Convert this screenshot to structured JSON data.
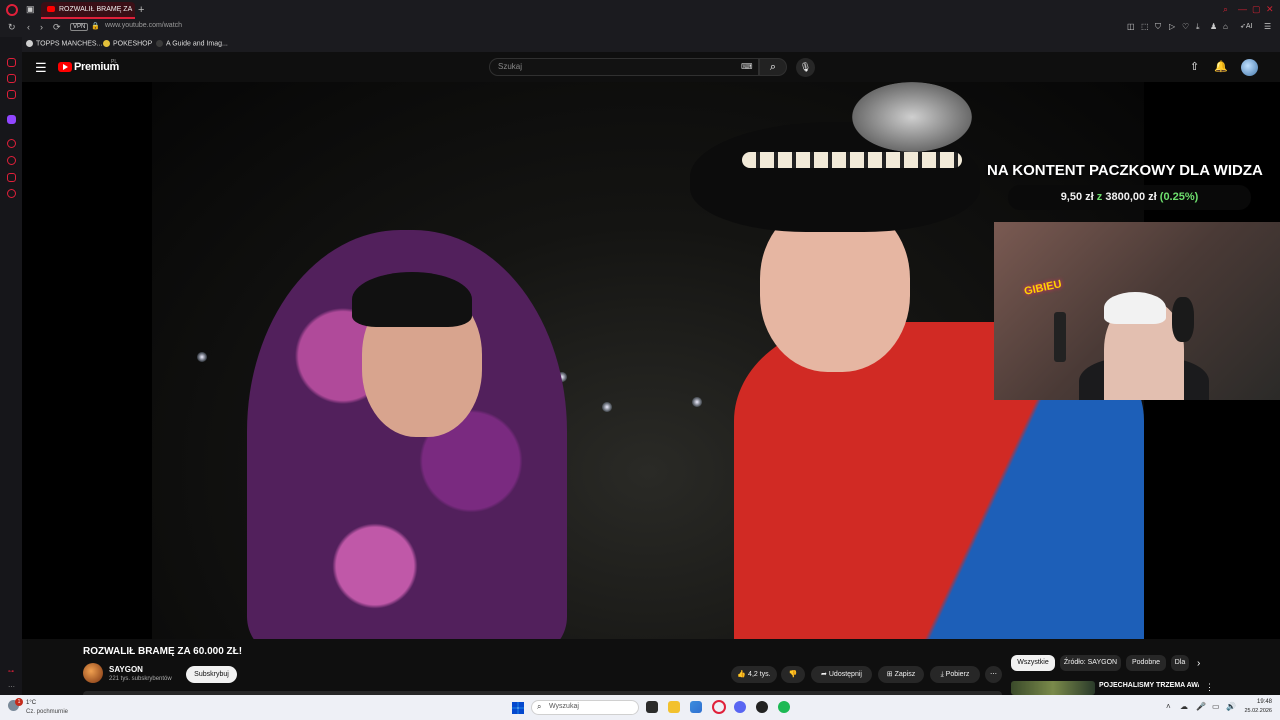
{
  "browser": {
    "tab_title": "ROZWALIŁ BRAMĘ ZA",
    "new_tab_symbol": "+",
    "url": "www.youtube.com/watch",
    "vpn_label": "VPN",
    "ai_label": "AI",
    "bookmarks": [
      {
        "label": "TOPPS MANCHES...",
        "icon": "dot-icon",
        "color": "#cfcfcf"
      },
      {
        "label": "POKESHOP",
        "icon": "pokeball-icon",
        "color": "#e3c03a"
      },
      {
        "label": "A Guide and Imag...",
        "icon": "page-icon",
        "color": "#3a3a3a"
      }
    ],
    "accent_color": "#e0203a"
  },
  "youtube": {
    "logo_text": "Premium",
    "region": "PL",
    "search_placeholder": "Szukaj",
    "video_title": "ROZWALIŁ BRAMĘ ZA 60.000 ZŁ!",
    "channel_name": "SAYGON",
    "subscribers": "221 tys. subskrybentów",
    "subscribe_label": "Subskrybuj",
    "likes": "4,2 tys.",
    "share_label": "Udostępnij",
    "save_label": "Zapisz",
    "download_label": "Pobierz",
    "more_symbol": "⋯",
    "chips": [
      "Wszystkie",
      "Źródło: SAYGON",
      "Podobne",
      "Dla"
    ],
    "recommended_title": "POJECHALIŚMY TRZEMA AWARYJNYMI AUTAMI DO"
  },
  "overlay": {
    "title": "NA KONTENT PACZKOWY DLA WIDZA",
    "current": "9,50 zł",
    "z": "z",
    "goal": "3800,00 zł",
    "percent": "(0.25%)",
    "neon_sign": "GIBIEU"
  },
  "taskbar": {
    "weather_badge": "1",
    "temperature": "1°C",
    "weather_condition": "Cz. pochmurnie",
    "search_label": "Wyszukaj",
    "time": "19:48",
    "date": "25.02.2026"
  }
}
